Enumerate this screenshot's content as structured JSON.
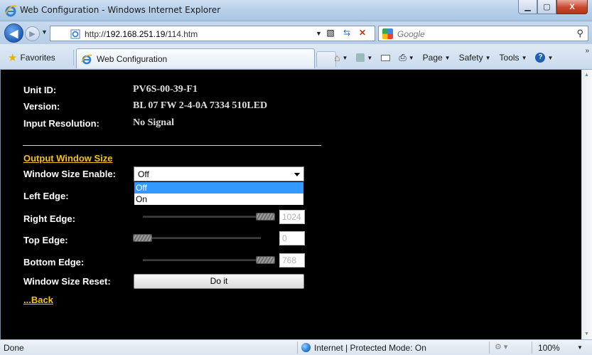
{
  "window": {
    "title": "Web Configuration - Windows Internet Explorer",
    "buttons": {
      "minimize": "▁",
      "maximize": "▢",
      "close": "X"
    }
  },
  "nav": {
    "back_label": "◀",
    "forward_label": "▶",
    "address_prefix": "http://",
    "address_host": "192.168.251.19",
    "address_path": "/114.htm",
    "search_placeholder": "Google"
  },
  "favbar": {
    "favorites_label": "Favorites",
    "tab_label": "Web Configuration",
    "commands": {
      "page": "Page",
      "safety": "Safety",
      "tools": "Tools"
    }
  },
  "device": {
    "unit_id_label": "Unit ID:",
    "unit_id_value": "PV6S-00-39-F1",
    "version_label": "Version:",
    "version_value": "BL 07 FW 2-4-0A 7334 510LED",
    "input_res_label": "Input Resolution:",
    "input_res_value": "No Signal"
  },
  "output": {
    "section_title": "Output Window Size",
    "enable_label": "Window Size Enable:",
    "enable_selected": "Off",
    "enable_options": [
      "Off",
      "On"
    ],
    "left_edge_label": "Left Edge:",
    "right_edge_label": "Right Edge:",
    "right_edge_value": "1024",
    "right_edge_level": 1.0,
    "top_edge_label": "Top Edge:",
    "top_edge_value": "0",
    "top_edge_level": 0.0,
    "bottom_edge_label": "Bottom Edge:",
    "bottom_edge_value": "768",
    "bottom_edge_level": 1.0,
    "reset_label": "Window Size Reset:",
    "reset_button": "Do it",
    "back_link": "...Back"
  },
  "status": {
    "left": "Done",
    "zone": "Internet | Protected Mode: On",
    "zoom": "100%"
  }
}
